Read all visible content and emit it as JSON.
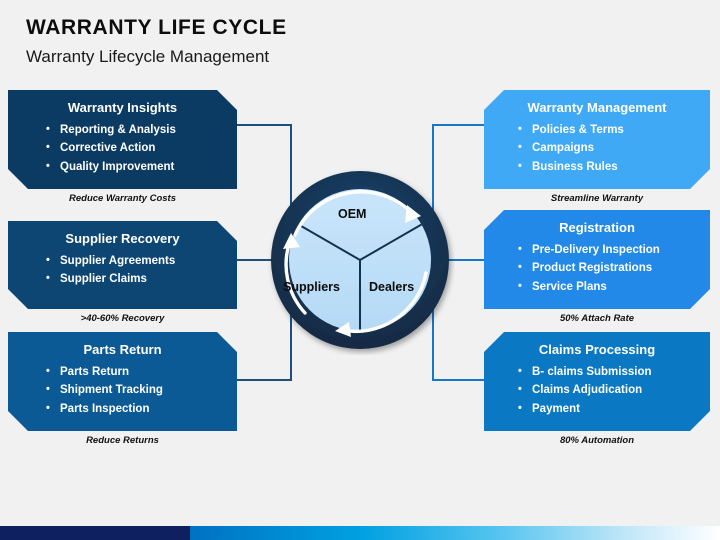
{
  "header": {
    "title": "WARRANTY LIFE CYCLE",
    "subtitle": "Warranty Lifecycle Management"
  },
  "colors": {
    "background": "#f1f1f1",
    "left_box_dark": "#0b3a63",
    "left_box_mid": "#0d4673",
    "left_box_light": "#0b5a96",
    "right_box_light": "#3fa9f5",
    "right_box_mid": "#2289e8",
    "right_box_dark": "#0b78c4",
    "wheel_ring": "#14304f",
    "wheel_fill": "#bfe0f7",
    "connector_left": "#1c4e80",
    "connector_right": "#1577c6",
    "footer_navy": "#0e2060",
    "footer_blue": "#0072c2"
  },
  "left_column": [
    {
      "title": "Warranty Insights",
      "items": [
        "Reporting & Analysis",
        "Corrective Action",
        "Quality Improvement"
      ],
      "caption": "Reduce Warranty Costs",
      "color": "#0b3a63"
    },
    {
      "title": "Supplier Recovery",
      "items": [
        "Supplier Agreements",
        "Supplier Claims"
      ],
      "caption": ">40-60% Recovery",
      "color": "#0d4673"
    },
    {
      "title": "Parts Return",
      "items": [
        "Parts Return",
        "Shipment Tracking",
        "Parts Inspection"
      ],
      "caption": "Reduce Returns",
      "color": "#0b5a96"
    }
  ],
  "right_column": [
    {
      "title": "Warranty Management",
      "items": [
        "Policies & Terms",
        "Campaigns",
        "Business Rules"
      ],
      "caption": "Streamline Warranty",
      "color": "#3fa9f5"
    },
    {
      "title": "Registration",
      "items": [
        "Pre-Delivery Inspection",
        "Product Registrations",
        "Service Plans"
      ],
      "caption": "50% Attach Rate",
      "color": "#2289e8"
    },
    {
      "title": "Claims Processing",
      "items": [
        "B- claims Submission",
        "Claims Adjudication",
        "Payment"
      ],
      "caption": "80% Automation",
      "color": "#0b78c4"
    }
  ],
  "wheel": {
    "segments": [
      {
        "label": "OEM"
      },
      {
        "label": "Suppliers"
      },
      {
        "label": "Dealers"
      }
    ],
    "arrow_direction": "clockwise"
  }
}
